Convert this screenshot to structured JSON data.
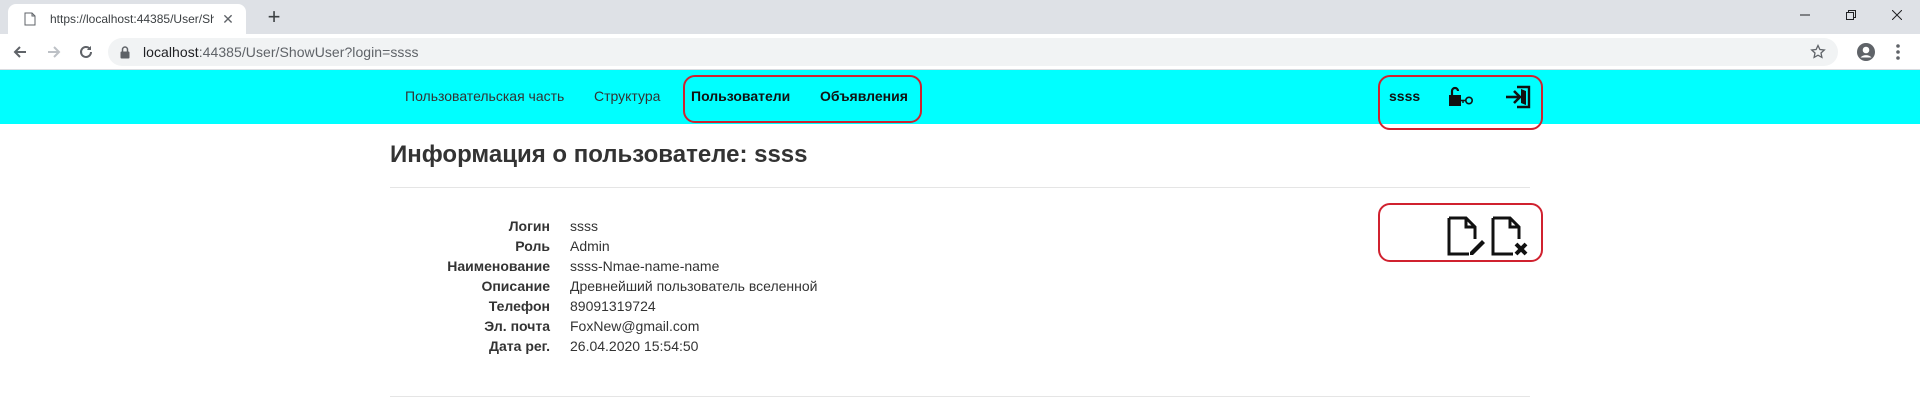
{
  "browser": {
    "tab_title": "https://localhost:44385/User/Sho",
    "url_host": "localhost",
    "url_rest": ":44385/User/ShowUser?login=ssss"
  },
  "nav": {
    "links": [
      "Пользовательская часть",
      "Структура",
      "Пользователи",
      "Объявления"
    ],
    "username": "ssss",
    "icons": [
      "lock-key-icon",
      "sign-out-icon"
    ]
  },
  "page": {
    "title_prefix": "Информация о пользователе: ",
    "title_user": "ssss"
  },
  "user": {
    "fields": [
      {
        "label": "Логин",
        "value": "ssss"
      },
      {
        "label": "Роль",
        "value": "Admin"
      },
      {
        "label": "Наименование",
        "value": "ssss-Nmae-name-name"
      },
      {
        "label": "Описание",
        "value": "Древнейший пользователь вселенной"
      },
      {
        "label": "Телефон",
        "value": "89091319724"
      },
      {
        "label": "Эл. почта",
        "value": "FoxNew@gmail.com"
      },
      {
        "label": "Дата рег.",
        "value": "26.04.2020 15:54:50"
      }
    ]
  },
  "actions": [
    "edit-file-icon",
    "delete-file-icon"
  ],
  "colors": {
    "navbar": "#00ffff",
    "highlight": "#d0212f",
    "tabstrip": "#dee1e6"
  }
}
